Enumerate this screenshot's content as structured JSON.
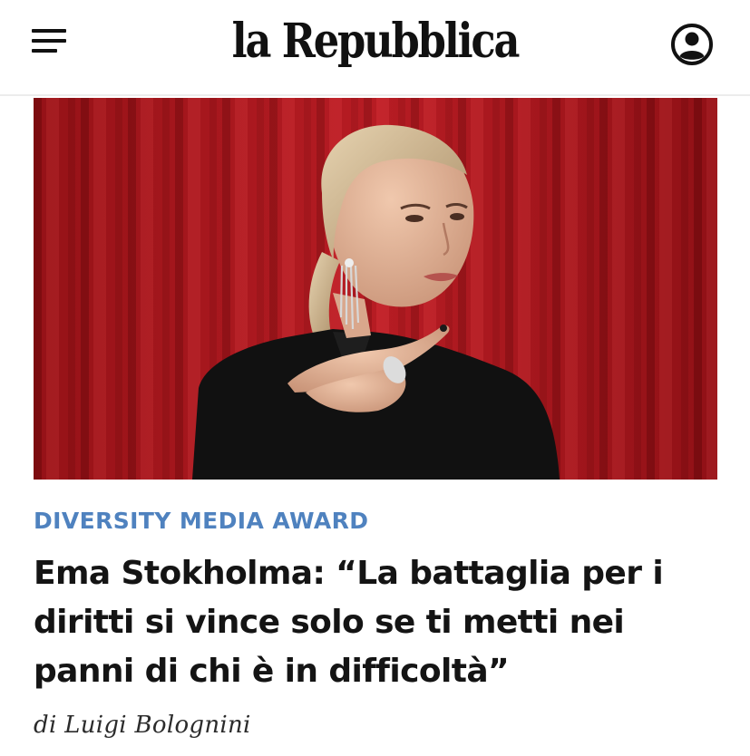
{
  "header": {
    "logo": "la Repubblica",
    "menu_icon": "hamburger-menu-icon",
    "account_icon": "user-account-icon"
  },
  "article": {
    "kicker": "DIVERSITY MEDIA AWARD",
    "headline": "Ema Stokholma: “La battaglia per i diritti si vince solo se ti metti nei panni di chi è in difficoltà”",
    "byline": "di Luigi Bolognini"
  },
  "colors": {
    "kicker": "#4f82bf",
    "headline": "#141414",
    "curtain": "#b81c22"
  }
}
